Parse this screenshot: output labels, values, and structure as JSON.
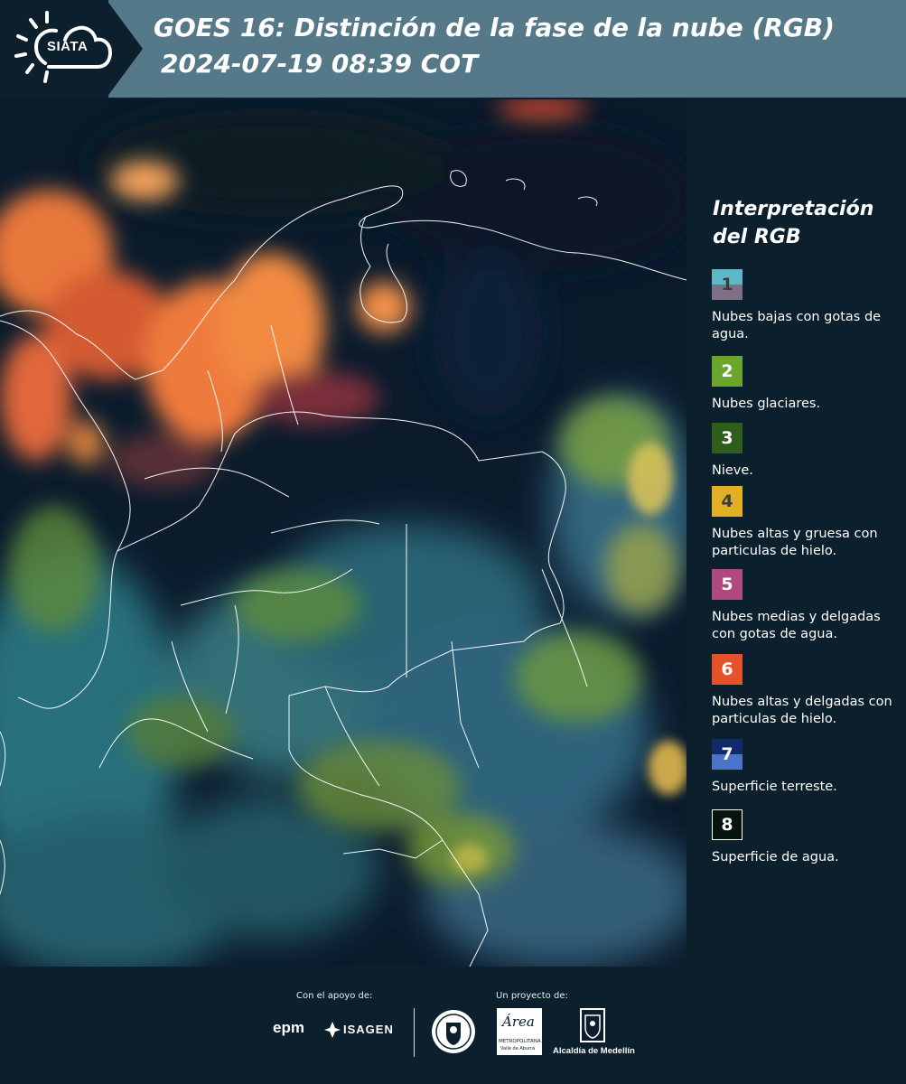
{
  "header": {
    "logo_text": "SIATA",
    "title_line1": "GOES 16: Distinción de la fase de la nube (RGB)",
    "title_line2": "2024-07-19 08:39 COT"
  },
  "legend": {
    "title_line1": "Interpretación",
    "title_line2": "del RGB",
    "items": [
      {
        "num": "1",
        "text": "Nubes bajas con gotas de agua.",
        "color_top": "#5fb6c6",
        "color_bottom": "#7e6e86",
        "num_color": "#3b3b3b"
      },
      {
        "num": "2",
        "text": "Nubes glaciares.",
        "color_top": "#6aa52c",
        "color_bottom": "#6aa52c",
        "num_color": "#ffffff"
      },
      {
        "num": "3",
        "text": "Nieve.",
        "color_top": "#2f5e1c",
        "color_bottom": "#2f5e1c",
        "num_color": "#ffffff"
      },
      {
        "num": "4",
        "text": "Nubes altas y gruesa con particulas de hielo.",
        "color_top": "#e1b123",
        "color_bottom": "#e1b123",
        "num_color": "#3b3b3b"
      },
      {
        "num": "5",
        "text": "Nubes medias y delgadas con gotas de agua.",
        "color_top": "#b0497e",
        "color_bottom": "#b0497e",
        "num_color": "#ffffff"
      },
      {
        "num": "6",
        "text": "Nubes altas y delgadas con particulas de hielo.",
        "color_top": "#e6532a",
        "color_bottom": "#e6532a",
        "num_color": "#ffffff"
      },
      {
        "num": "7",
        "text": "Superficie terreste.",
        "color_top": "#102a6a",
        "color_bottom": "#4b74c9",
        "num_color": "#ffffff"
      },
      {
        "num": "8",
        "text": "Superficie de agua.",
        "color_top": "#07140d",
        "color_bottom": "#07140d",
        "num_color": "#ffffff"
      }
    ]
  },
  "footer": {
    "support_label": "Con el apoyo de:",
    "project_label": "Un proyecto de:",
    "epm": "epm",
    "isagen": "ISAGEN",
    "area_line1": "METROPOLITANA",
    "area_line2": "Valle de Aburrá",
    "area_word": "Área",
    "alcaldia": "Alcaldía de Medellín"
  }
}
